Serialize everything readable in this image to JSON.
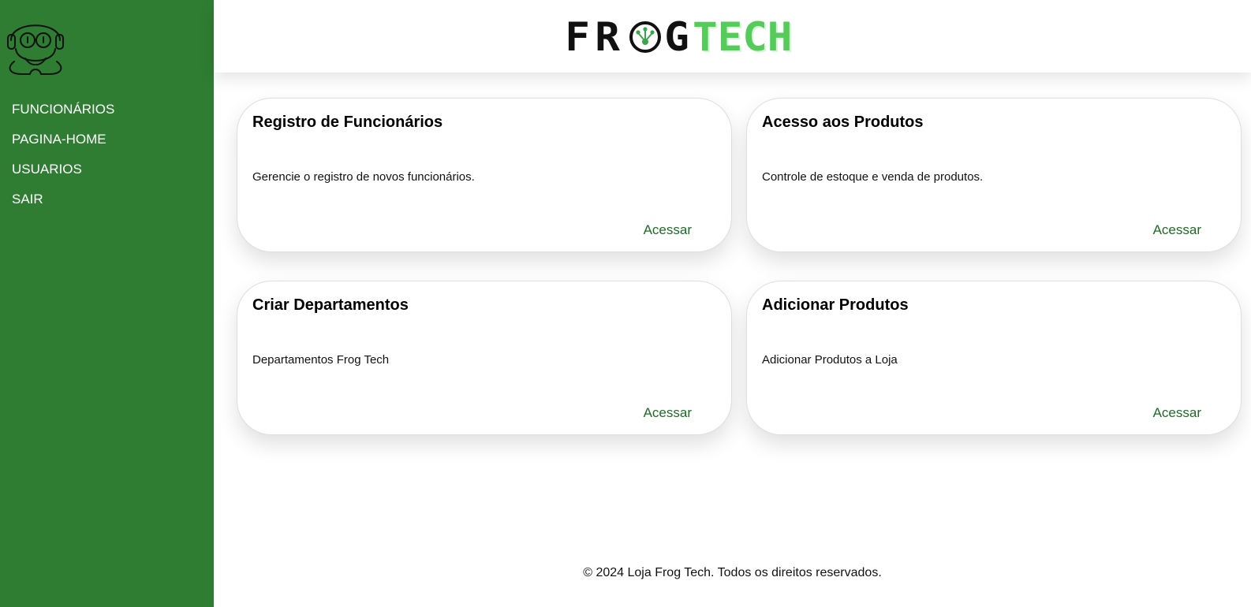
{
  "brand": {
    "frog_letters": [
      "F",
      "R"
    ],
    "frog_tail": "G",
    "tech_letters": "TECH",
    "colors": {
      "sidebar": "#2e7d32",
      "tech": "#55cc5a",
      "frog": "#111111",
      "link": "#1f6b26"
    }
  },
  "sidebar": {
    "logo_icon": "frog-headphones-icon",
    "items": [
      {
        "label": "FUNCIONÁRIOS"
      },
      {
        "label": "PAGINA-HOME"
      },
      {
        "label": "USUARIOS"
      },
      {
        "label": "SAIR"
      }
    ]
  },
  "cards": [
    {
      "title": "Registro de Funcionários",
      "description": "Gerencie o registro de novos funcionários.",
      "link": "Acessar"
    },
    {
      "title": "Acesso aos Produtos",
      "description": "Controle de estoque e venda de produtos.",
      "link": "Acessar"
    },
    {
      "title": "Criar Departamentos",
      "description": "Departamentos Frog Tech",
      "link": "Acessar"
    },
    {
      "title": "Adicionar Produtos",
      "description": "Adicionar Produtos a Loja",
      "link": "Acessar"
    }
  ],
  "footer": {
    "text": "© 2024 Loja Frog Tech. Todos os direitos reservados."
  }
}
